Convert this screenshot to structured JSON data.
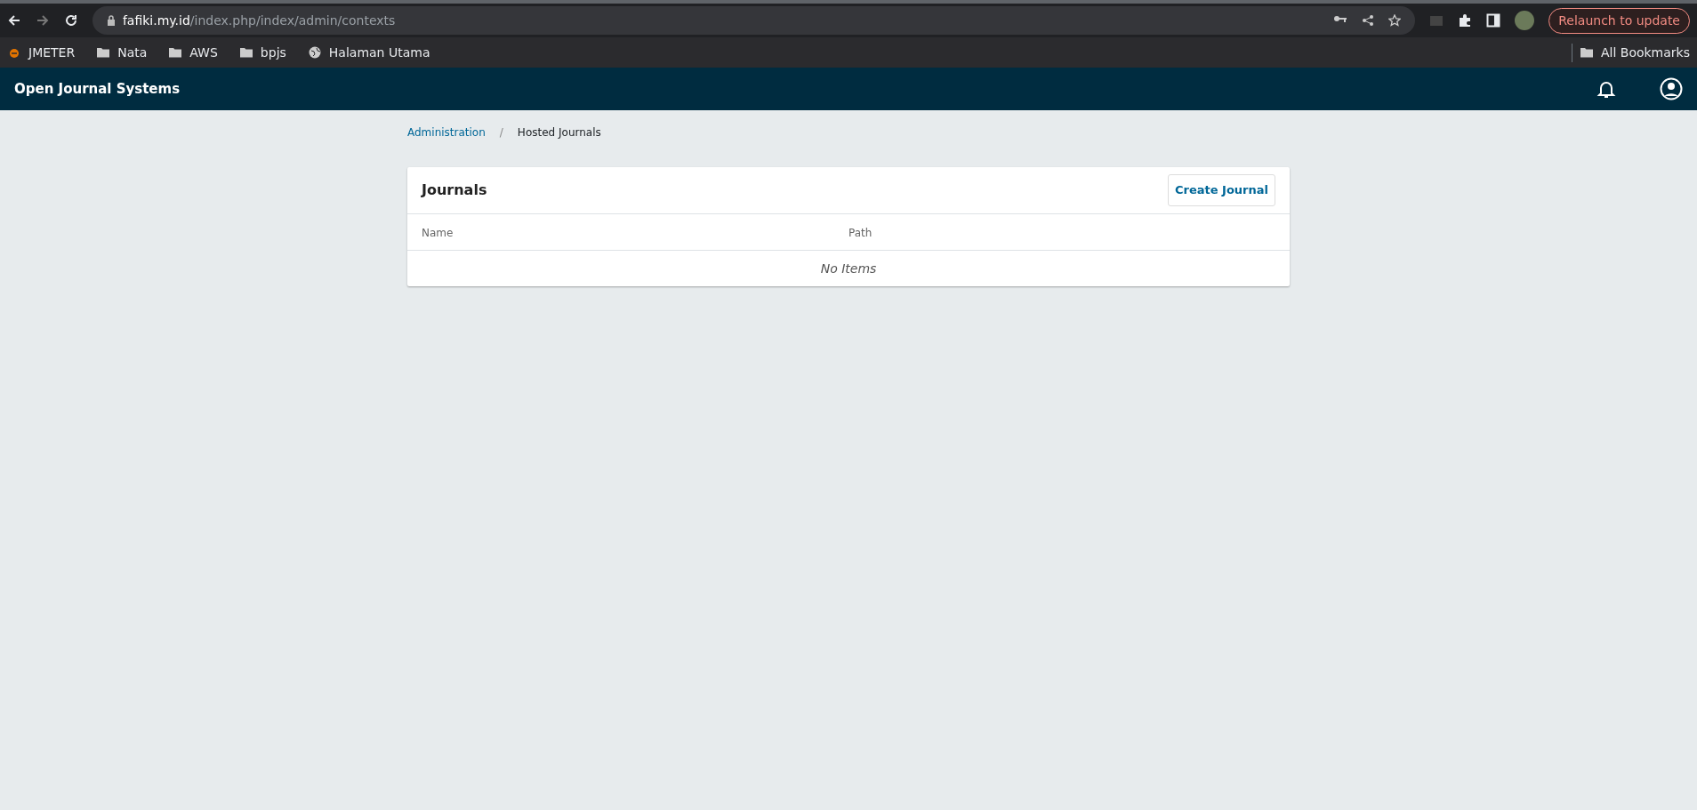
{
  "browser": {
    "url_host": "fafiki.my.id",
    "url_path": "/index.php/index/admin/contexts",
    "relaunch_button": "Relaunch to update",
    "bookmarks": [
      {
        "kind": "app",
        "label": "JMETER"
      },
      {
        "kind": "folder",
        "label": "Nata"
      },
      {
        "kind": "folder",
        "label": "AWS"
      },
      {
        "kind": "folder",
        "label": "bpjs"
      },
      {
        "kind": "globe",
        "label": "Halaman Utama"
      }
    ],
    "all_bookmarks": "All Bookmarks"
  },
  "header": {
    "site_title": "Open Journal Systems"
  },
  "breadcrumb_separator": "/",
  "breadcrumb": [
    {
      "label": "Administration",
      "link": true
    },
    {
      "label": "Hosted Journals",
      "link": false
    }
  ],
  "panel": {
    "title": "Journals",
    "button": "Create Journal",
    "columns": [
      "Name",
      "Path"
    ],
    "empty_message": "No Items"
  }
}
